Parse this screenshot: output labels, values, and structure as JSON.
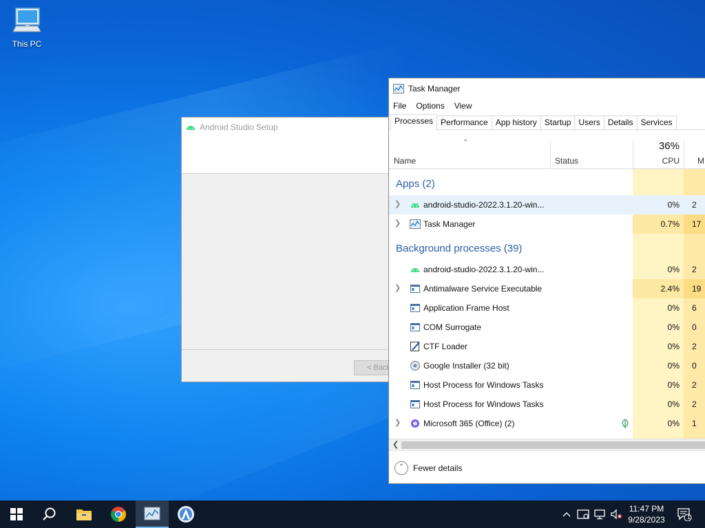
{
  "desktop": {
    "icons": [
      {
        "label": "This PC",
        "icon": "computer-icon"
      }
    ]
  },
  "android_setup": {
    "title": "Android Studio Setup",
    "back_button": "< Back"
  },
  "task_manager": {
    "title": "Task Manager",
    "menu": [
      "File",
      "Options",
      "View"
    ],
    "tabs": [
      "Processes",
      "Performance",
      "App history",
      "Startup",
      "Users",
      "Details",
      "Services"
    ],
    "active_tab": "Processes",
    "columns": {
      "name": "Name",
      "status": "Status",
      "cpu_total": "36%",
      "cpu": "CPU",
      "mem": "M"
    },
    "groups": {
      "apps": "Apps (2)",
      "background": "Background processes (39)"
    },
    "apps": [
      {
        "name": "android-studio-2022.3.1.20-win...",
        "cpu": "0%",
        "mem": "2",
        "expand": true,
        "icon": "android-icon",
        "highlight": true
      },
      {
        "name": "Task Manager",
        "cpu": "0.7%",
        "mem": "17",
        "expand": true,
        "icon": "task-manager-icon"
      }
    ],
    "background": [
      {
        "name": "android-studio-2022.3.1.20-win...",
        "cpu": "0%",
        "mem": "2",
        "expand": false,
        "icon": "android-icon"
      },
      {
        "name": "Antimalware Service Executable",
        "cpu": "2.4%",
        "mem": "19",
        "expand": true,
        "icon": "service-icon"
      },
      {
        "name": "Application Frame Host",
        "cpu": "0%",
        "mem": "6",
        "expand": false,
        "icon": "service-icon"
      },
      {
        "name": "COM Surrogate",
        "cpu": "0%",
        "mem": "0",
        "expand": false,
        "icon": "service-icon"
      },
      {
        "name": "CTF Loader",
        "cpu": "0%",
        "mem": "2",
        "expand": false,
        "icon": "pen-icon"
      },
      {
        "name": "Google Installer (32 bit)",
        "cpu": "0%",
        "mem": "0",
        "expand": false,
        "icon": "installer-icon"
      },
      {
        "name": "Host Process for Windows Tasks",
        "cpu": "0%",
        "mem": "2",
        "expand": false,
        "icon": "service-icon"
      },
      {
        "name": "Host Process for Windows Tasks",
        "cpu": "0%",
        "mem": "2",
        "expand": false,
        "icon": "service-icon"
      },
      {
        "name": "Microsoft 365 (Office) (2)",
        "cpu": "0%",
        "mem": "1",
        "expand": true,
        "icon": "office-icon",
        "eco": true
      }
    ],
    "footer": {
      "fewer_details": "Fewer details"
    }
  },
  "taskbar": {
    "items": [
      "start-icon",
      "search-icon",
      "file-explorer-icon",
      "chrome-icon",
      "task-manager-icon",
      "android-studio-icon"
    ],
    "active_item": "task-manager-icon",
    "clock": {
      "time": "11:47 PM",
      "date": "9/28/2023"
    },
    "notification_count": "1"
  }
}
